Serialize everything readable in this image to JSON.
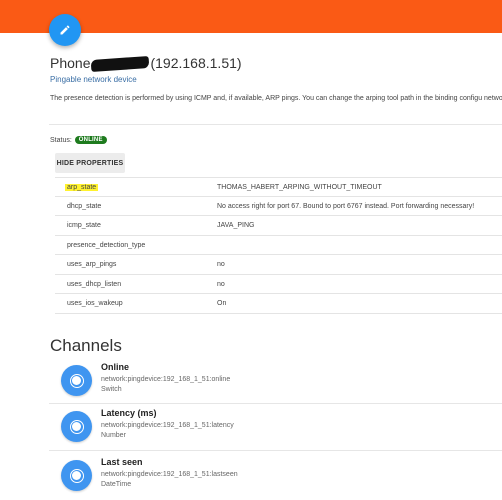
{
  "header": {
    "edit_icon": "pencil-icon",
    "accent": "#fa5a15",
    "fab_color": "#2196f3"
  },
  "thing": {
    "title_prefix": "Phone",
    "title_suffix": "(192.168.1.51)",
    "subtitle": "Pingable network device",
    "description": "The presence detection is performed by using ICMP and, if available, ARP pings. You can change the arping tool path in the binding configu network reentry discovery.",
    "status_label": "Status:",
    "status": "ONLINE"
  },
  "properties": {
    "toggle_label": "HIDE PROPERTIES",
    "rows": [
      {
        "key": "arp_state",
        "value": "THOMAS_HABERT_ARPING_WITHOUT_TIMEOUT"
      },
      {
        "key": "dhcp_state",
        "value": "No access right for port 67. Bound to port 6767 instead. Port forwarding necessary!"
      },
      {
        "key": "icmp_state",
        "value": "JAVA_PING"
      },
      {
        "key": "presence_detection_type",
        "value": ""
      },
      {
        "key": "uses_arp_pings",
        "value": "no"
      },
      {
        "key": "uses_dhcp_listen",
        "value": "no"
      },
      {
        "key": "uses_ios_wakeup",
        "value": "On"
      }
    ]
  },
  "channels": {
    "heading": "Channels",
    "items": [
      {
        "name": "Online",
        "uid": "network:pingdevice:192_168_1_51:online",
        "type": "Switch"
      },
      {
        "name": "Latency (ms)",
        "uid": "network:pingdevice:192_168_1_51:latency",
        "type": "Number"
      },
      {
        "name": "Last seen",
        "uid": "network:pingdevice:192_168_1_51:lastseen",
        "type": "DateTime"
      }
    ]
  }
}
